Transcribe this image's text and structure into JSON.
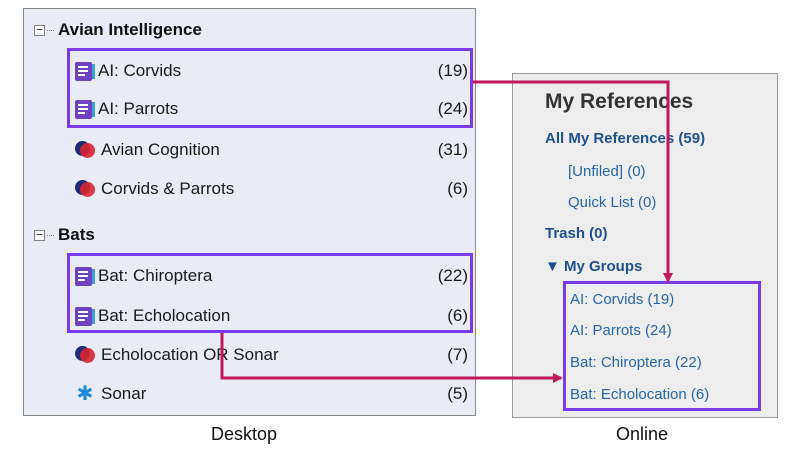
{
  "desktop": {
    "groups": [
      {
        "label": "Avian Intelligence",
        "toggle": "−"
      },
      {
        "label": "Bats",
        "toggle": "−"
      }
    ],
    "rows": [
      {
        "icon": "group-doc-icon",
        "label": "AI: Corvids",
        "count": "(19)"
      },
      {
        "icon": "group-doc-icon",
        "label": "AI: Parrots",
        "count": "(24)"
      },
      {
        "icon": "smart-group-icon",
        "label": "Avian Cognition",
        "count": "(31)"
      },
      {
        "icon": "smart-group-icon",
        "label": "Corvids & Parrots",
        "count": "(6)"
      },
      {
        "icon": "group-doc-icon",
        "label": "Bat: Chiroptera",
        "count": "(22)"
      },
      {
        "icon": "group-doc-icon",
        "label": "Bat: Echolocation",
        "count": "(6)"
      },
      {
        "icon": "smart-group-icon",
        "label": "Echolocation OR Sonar",
        "count": "(7)"
      },
      {
        "icon": "gear-icon",
        "label": "Sonar",
        "count": "(5)"
      }
    ],
    "caption": "Desktop"
  },
  "online": {
    "title": "My References",
    "all": "All My References (59)",
    "unfiled": "[Unfiled] (0)",
    "quick_list": "Quick List (0)",
    "trash": "Trash (0)",
    "my_groups": "▼ My Groups",
    "groups": [
      "AI: Corvids  (19)",
      "AI: Parrots  (24)",
      "Bat: Chiroptera  (22)",
      "Bat: Echolocation  (6)"
    ],
    "caption": "Online"
  },
  "colors": {
    "highlight_box": "#7c3aed",
    "arrow": "#c2185b",
    "desktop_bg": "#e9ebf7",
    "online_bg": "#ededed"
  }
}
